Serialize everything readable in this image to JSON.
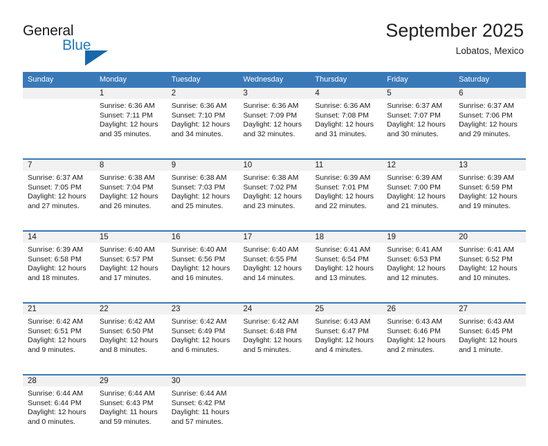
{
  "brand": {
    "name_part1": "General",
    "name_part2": "Blue",
    "accent_color": "#1668ad",
    "triangle_icon": "brand-triangle-icon"
  },
  "header": {
    "title": "September 2025",
    "subtitle": "Lobatos, Mexico"
  },
  "calendar": {
    "header_color": "#3a79b8",
    "weekday_headers": [
      "Sunday",
      "Monday",
      "Tuesday",
      "Wednesday",
      "Thursday",
      "Friday",
      "Saturday"
    ],
    "weeks": [
      [
        {
          "day": "",
          "sunrise": "",
          "sunset": "",
          "daylight1": "",
          "daylight2": "",
          "empty": true
        },
        {
          "day": "1",
          "sunrise": "Sunrise: 6:36 AM",
          "sunset": "Sunset: 7:11 PM",
          "daylight1": "Daylight: 12 hours",
          "daylight2": "and 35 minutes."
        },
        {
          "day": "2",
          "sunrise": "Sunrise: 6:36 AM",
          "sunset": "Sunset: 7:10 PM",
          "daylight1": "Daylight: 12 hours",
          "daylight2": "and 34 minutes."
        },
        {
          "day": "3",
          "sunrise": "Sunrise: 6:36 AM",
          "sunset": "Sunset: 7:09 PM",
          "daylight1": "Daylight: 12 hours",
          "daylight2": "and 32 minutes."
        },
        {
          "day": "4",
          "sunrise": "Sunrise: 6:36 AM",
          "sunset": "Sunset: 7:08 PM",
          "daylight1": "Daylight: 12 hours",
          "daylight2": "and 31 minutes."
        },
        {
          "day": "5",
          "sunrise": "Sunrise: 6:37 AM",
          "sunset": "Sunset: 7:07 PM",
          "daylight1": "Daylight: 12 hours",
          "daylight2": "and 30 minutes."
        },
        {
          "day": "6",
          "sunrise": "Sunrise: 6:37 AM",
          "sunset": "Sunset: 7:06 PM",
          "daylight1": "Daylight: 12 hours",
          "daylight2": "and 29 minutes."
        }
      ],
      [
        {
          "day": "7",
          "sunrise": "Sunrise: 6:37 AM",
          "sunset": "Sunset: 7:05 PM",
          "daylight1": "Daylight: 12 hours",
          "daylight2": "and 27 minutes."
        },
        {
          "day": "8",
          "sunrise": "Sunrise: 6:38 AM",
          "sunset": "Sunset: 7:04 PM",
          "daylight1": "Daylight: 12 hours",
          "daylight2": "and 26 minutes."
        },
        {
          "day": "9",
          "sunrise": "Sunrise: 6:38 AM",
          "sunset": "Sunset: 7:03 PM",
          "daylight1": "Daylight: 12 hours",
          "daylight2": "and 25 minutes."
        },
        {
          "day": "10",
          "sunrise": "Sunrise: 6:38 AM",
          "sunset": "Sunset: 7:02 PM",
          "daylight1": "Daylight: 12 hours",
          "daylight2": "and 23 minutes."
        },
        {
          "day": "11",
          "sunrise": "Sunrise: 6:39 AM",
          "sunset": "Sunset: 7:01 PM",
          "daylight1": "Daylight: 12 hours",
          "daylight2": "and 22 minutes."
        },
        {
          "day": "12",
          "sunrise": "Sunrise: 6:39 AM",
          "sunset": "Sunset: 7:00 PM",
          "daylight1": "Daylight: 12 hours",
          "daylight2": "and 21 minutes."
        },
        {
          "day": "13",
          "sunrise": "Sunrise: 6:39 AM",
          "sunset": "Sunset: 6:59 PM",
          "daylight1": "Daylight: 12 hours",
          "daylight2": "and 19 minutes."
        }
      ],
      [
        {
          "day": "14",
          "sunrise": "Sunrise: 6:39 AM",
          "sunset": "Sunset: 6:58 PM",
          "daylight1": "Daylight: 12 hours",
          "daylight2": "and 18 minutes."
        },
        {
          "day": "15",
          "sunrise": "Sunrise: 6:40 AM",
          "sunset": "Sunset: 6:57 PM",
          "daylight1": "Daylight: 12 hours",
          "daylight2": "and 17 minutes."
        },
        {
          "day": "16",
          "sunrise": "Sunrise: 6:40 AM",
          "sunset": "Sunset: 6:56 PM",
          "daylight1": "Daylight: 12 hours",
          "daylight2": "and 16 minutes."
        },
        {
          "day": "17",
          "sunrise": "Sunrise: 6:40 AM",
          "sunset": "Sunset: 6:55 PM",
          "daylight1": "Daylight: 12 hours",
          "daylight2": "and 14 minutes."
        },
        {
          "day": "18",
          "sunrise": "Sunrise: 6:41 AM",
          "sunset": "Sunset: 6:54 PM",
          "daylight1": "Daylight: 12 hours",
          "daylight2": "and 13 minutes."
        },
        {
          "day": "19",
          "sunrise": "Sunrise: 6:41 AM",
          "sunset": "Sunset: 6:53 PM",
          "daylight1": "Daylight: 12 hours",
          "daylight2": "and 12 minutes."
        },
        {
          "day": "20",
          "sunrise": "Sunrise: 6:41 AM",
          "sunset": "Sunset: 6:52 PM",
          "daylight1": "Daylight: 12 hours",
          "daylight2": "and 10 minutes."
        }
      ],
      [
        {
          "day": "21",
          "sunrise": "Sunrise: 6:42 AM",
          "sunset": "Sunset: 6:51 PM",
          "daylight1": "Daylight: 12 hours",
          "daylight2": "and 9 minutes."
        },
        {
          "day": "22",
          "sunrise": "Sunrise: 6:42 AM",
          "sunset": "Sunset: 6:50 PM",
          "daylight1": "Daylight: 12 hours",
          "daylight2": "and 8 minutes."
        },
        {
          "day": "23",
          "sunrise": "Sunrise: 6:42 AM",
          "sunset": "Sunset: 6:49 PM",
          "daylight1": "Daylight: 12 hours",
          "daylight2": "and 6 minutes."
        },
        {
          "day": "24",
          "sunrise": "Sunrise: 6:42 AM",
          "sunset": "Sunset: 6:48 PM",
          "daylight1": "Daylight: 12 hours",
          "daylight2": "and 5 minutes."
        },
        {
          "day": "25",
          "sunrise": "Sunrise: 6:43 AM",
          "sunset": "Sunset: 6:47 PM",
          "daylight1": "Daylight: 12 hours",
          "daylight2": "and 4 minutes."
        },
        {
          "day": "26",
          "sunrise": "Sunrise: 6:43 AM",
          "sunset": "Sunset: 6:46 PM",
          "daylight1": "Daylight: 12 hours",
          "daylight2": "and 2 minutes."
        },
        {
          "day": "27",
          "sunrise": "Sunrise: 6:43 AM",
          "sunset": "Sunset: 6:45 PM",
          "daylight1": "Daylight: 12 hours",
          "daylight2": "and 1 minute."
        }
      ],
      [
        {
          "day": "28",
          "sunrise": "Sunrise: 6:44 AM",
          "sunset": "Sunset: 6:44 PM",
          "daylight1": "Daylight: 12 hours",
          "daylight2": "and 0 minutes."
        },
        {
          "day": "29",
          "sunrise": "Sunrise: 6:44 AM",
          "sunset": "Sunset: 6:43 PM",
          "daylight1": "Daylight: 11 hours",
          "daylight2": "and 59 minutes."
        },
        {
          "day": "30",
          "sunrise": "Sunrise: 6:44 AM",
          "sunset": "Sunset: 6:42 PM",
          "daylight1": "Daylight: 11 hours",
          "daylight2": "and 57 minutes."
        },
        {
          "day": "",
          "sunrise": "",
          "sunset": "",
          "daylight1": "",
          "daylight2": "",
          "empty": true
        },
        {
          "day": "",
          "sunrise": "",
          "sunset": "",
          "daylight1": "",
          "daylight2": "",
          "empty": true
        },
        {
          "day": "",
          "sunrise": "",
          "sunset": "",
          "daylight1": "",
          "daylight2": "",
          "empty": true
        },
        {
          "day": "",
          "sunrise": "",
          "sunset": "",
          "daylight1": "",
          "daylight2": "",
          "empty": true
        }
      ]
    ]
  }
}
